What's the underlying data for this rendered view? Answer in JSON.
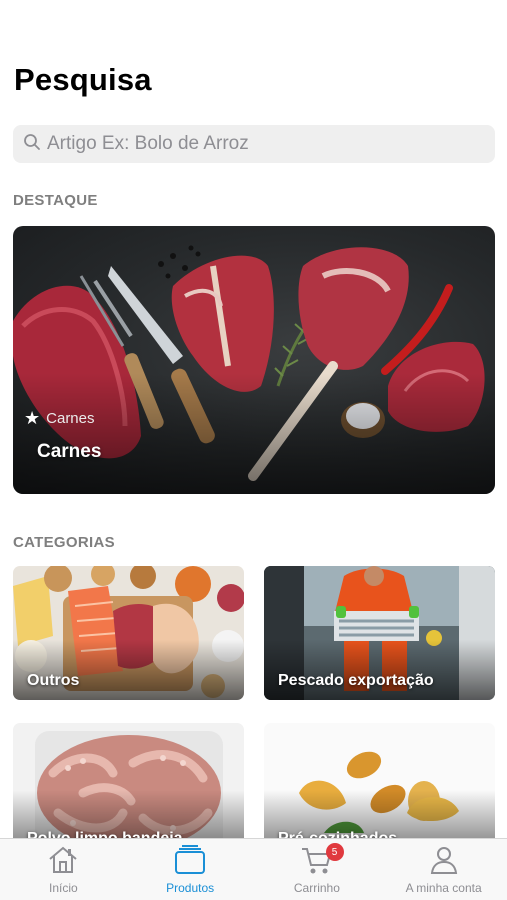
{
  "page": {
    "title": "Pesquisa"
  },
  "search": {
    "placeholder": "Artigo Ex: Bolo de Arroz"
  },
  "featured": {
    "section_label": "DESTAQUE",
    "category": "Carnes",
    "title": "Carnes"
  },
  "categories": {
    "section_label": "CATEGORIAS",
    "items": [
      {
        "label": "Outros"
      },
      {
        "label": "Pescado exportação"
      },
      {
        "label": "Polvo limpo bandeja"
      },
      {
        "label": "Pré-cozinhados"
      }
    ]
  },
  "tabbar": {
    "items": [
      {
        "label": "Início",
        "icon": "home-icon"
      },
      {
        "label": "Produtos",
        "icon": "products-icon"
      },
      {
        "label": "Carrinho",
        "icon": "cart-icon",
        "badge": "5"
      },
      {
        "label": "A minha conta",
        "icon": "user-icon"
      }
    ],
    "active_color": "#1a8fd6",
    "inactive_color": "#8e8e93"
  }
}
